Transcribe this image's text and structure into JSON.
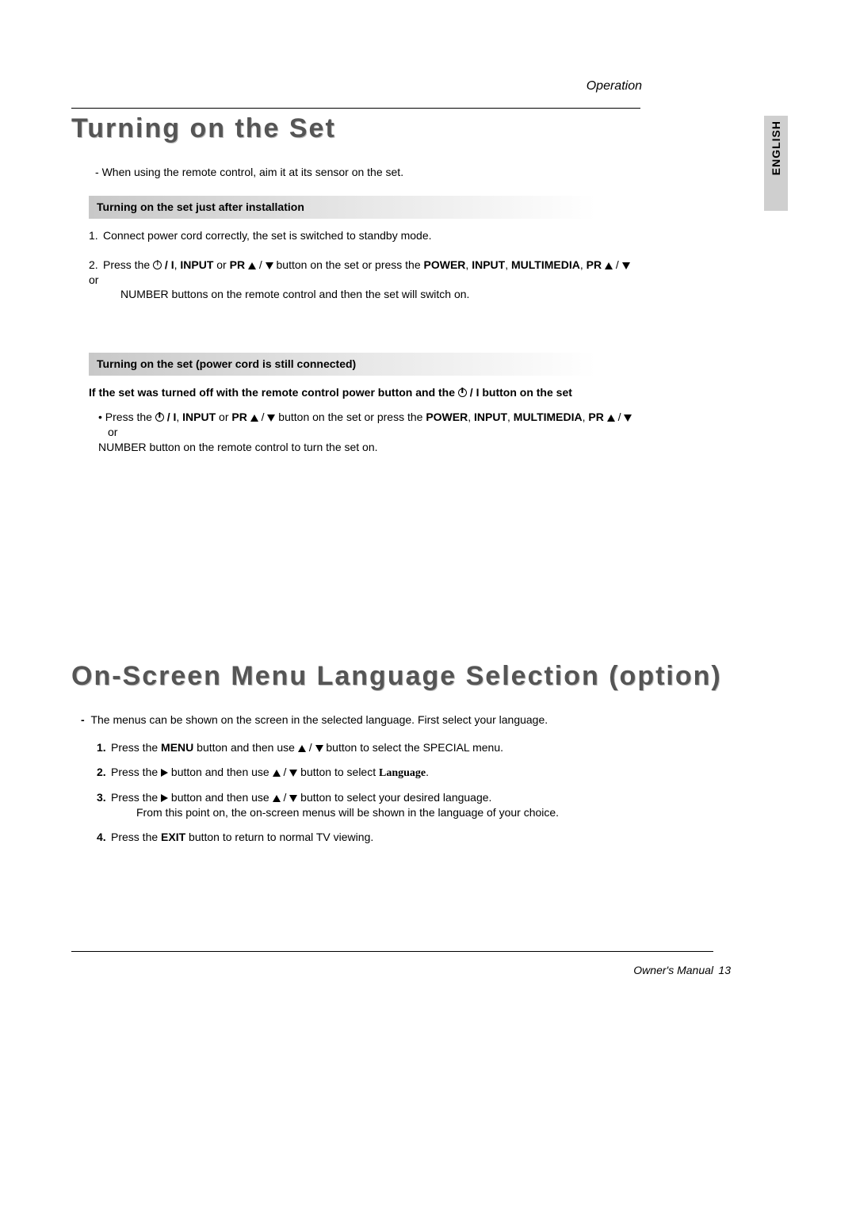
{
  "header": {
    "section": "Operation"
  },
  "lang_tab": "ENGLISH",
  "section1": {
    "title": "Turning on the Set",
    "intro_dash": "When using the remote control, aim it at its sensor on the set.",
    "sub1": {
      "heading": "Turning on the set just after installation",
      "step1": "Connect power cord correctly, the set is switched to standby mode.",
      "step2_a": "Press the ",
      "step2_b": " / I",
      "step2_c": ", ",
      "step2_d": "INPUT",
      "step2_e": " or ",
      "step2_f": "PR",
      "step2_g": " / ",
      "step2_h": " button on the set or press the ",
      "step2_i": "POWER",
      "step2_j": ", ",
      "step2_k": "INPUT",
      "step2_l": ", ",
      "step2_m": "MULTIMEDIA",
      "step2_n": ", ",
      "step2_o": "PR",
      "step2_p": " / ",
      "step2_q": " or",
      "step2_cont": "NUMBER buttons on the remote control and then the set will switch on."
    },
    "sub2": {
      "heading": "Turning on the set (power cord is still connected)",
      "if_a": "If the set was turned off with the remote control power button and the ",
      "if_b": " / I button on the set",
      "bullet_a": "Press the ",
      "bullet_b": " / I",
      "bullet_c": ", ",
      "bullet_d": "INPUT",
      "bullet_e": " or ",
      "bullet_f": "PR",
      "bullet_g": " / ",
      "bullet_h": " button on the set or press the ",
      "bullet_i": "POWER",
      "bullet_j": ", ",
      "bullet_k": "INPUT",
      "bullet_l": ", ",
      "bullet_m": "MULTIMEDIA",
      "bullet_n": ", ",
      "bullet_o": "PR",
      "bullet_p": " / ",
      "bullet_q": " or",
      "bullet_cont": "NUMBER button on the remote control to turn the set on."
    }
  },
  "section2": {
    "title": "On-Screen Menu Language Selection (option)",
    "lead_a": "The menus can be shown on the screen in the selected language. First select your language.",
    "step1_a": "Press the ",
    "step1_b": "MENU",
    "step1_c": " button and then use ",
    "step1_d": " / ",
    "step1_e": " button to select the SPECIAL menu.",
    "step2_a": "Press the ",
    "step2_b": " button and then use ",
    "step2_c": " / ",
    "step2_d": "  button to select ",
    "step2_e": "Language",
    "step2_f": ".",
    "step3_a": "Press the ",
    "step3_b": " button and then use ",
    "step3_c": " / ",
    "step3_d": " button to select your desired language.",
    "step3_cont": "From this point on, the on-screen menus will be shown in the language of your choice.",
    "step4_a": "Press the ",
    "step4_b": "EXIT",
    "step4_c": " button to return to normal TV viewing."
  },
  "footer": {
    "label": "Owner's Manual",
    "page": "13"
  }
}
